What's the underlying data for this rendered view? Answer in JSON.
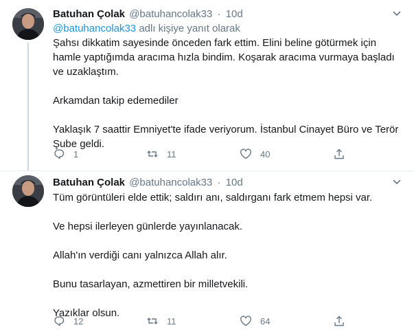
{
  "tweets": [
    {
      "author_name": "Batuhan Çolak",
      "handle": "@batuhancolak33",
      "separator": "·",
      "time": "10d",
      "reply_prefix": "@batuhancolak33",
      "reply_suffix": " adlı kişiye yanıt olarak",
      "paragraphs": [
        "Şahsı dikkatim sayesinde önceden fark ettim. Elini beline götürmek için hamle yaptığımda aracıma hızla bindim. Koşarak aracıma vurmaya başladı ve uzaklaştım.",
        "Arkamdan takip edemediler",
        "Yaklaşık 7 saattir Emniyet'te ifade veriyorum. İstanbul Cinayet Büro ve Terör Şube geldi."
      ],
      "replies": "1",
      "retweets": "11",
      "likes": "40"
    },
    {
      "author_name": "Batuhan Çolak",
      "handle": "@batuhancolak33",
      "separator": "·",
      "time": "10d",
      "paragraphs": [
        "Tüm görüntüleri elde ettik; saldırı anı, saldırganı fark etmem hepsi var.",
        "Ve hepsi ilerleyen günlerde yayınlanacak.",
        "Allah'ın verdiği canı yalnızca Allah alır.",
        "Bunu tasarlayan, azmettiren bir milletvekili.",
        "Yazıklar olsun."
      ],
      "replies": "12",
      "retweets": "11",
      "likes": "64"
    }
  ],
  "icons": {
    "reply": "reply-icon",
    "retweet": "retweet-icon",
    "like": "heart-icon",
    "share": "share-icon",
    "menu": "chevron-down-icon"
  },
  "colors": {
    "text": "#14171a",
    "secondary": "#657786",
    "link": "#1b95e0",
    "thread_line": "#ccd6dd"
  }
}
